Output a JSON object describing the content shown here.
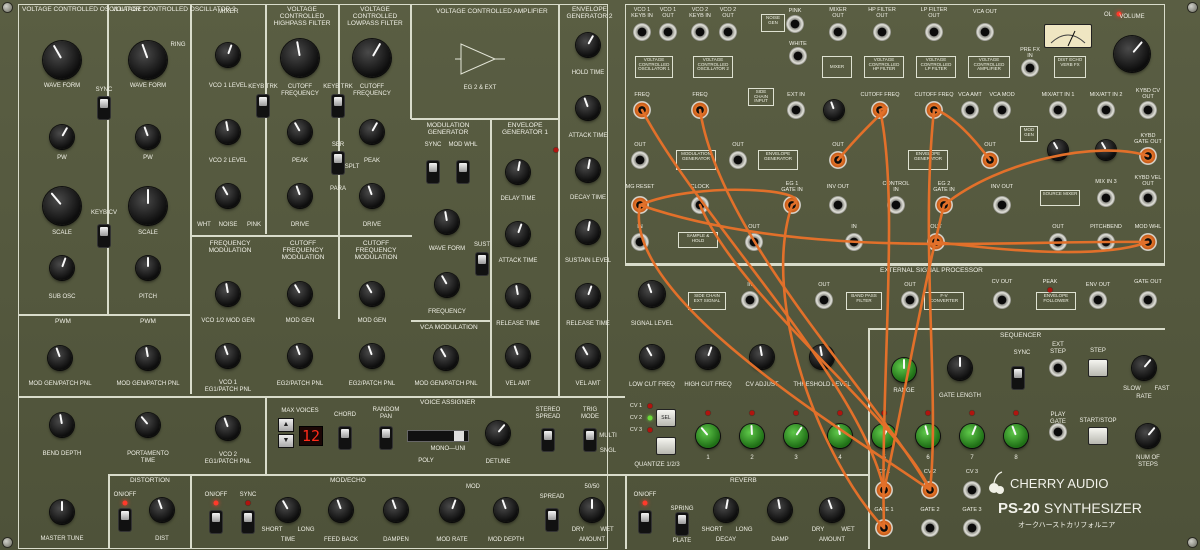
{
  "brand": {
    "company": "CHERRY AUDIO",
    "model_bold": "PS-20",
    "model_rest": "SYNTHESIZER",
    "japanese": "オークハーストカリフォルニア"
  },
  "sections": {
    "vco1": "VOLTAGE CONTROLLED OSCILLATOR  1",
    "vco2": "VOLTAGE CONTROLLED OSCILLATOR  2",
    "mixer": "MIXER",
    "hpf": "VOLTAGE CONTROLLED HIGHPASS FILTER",
    "lpf": "VOLTAGE CONTROLLED LOWPASS FILTER",
    "vca": "VOLTAGE CONTROLLED AMPLIFIER",
    "env2": "ENVELOPE GENERATOR 2",
    "modgen": "MODULATION GENERATOR",
    "env1": "ENVELOPE GENERATOR 1",
    "vcamod": "VCA MODULATION",
    "freqmod": "FREQUENCY MODULATION",
    "cutmod1": "CUTOFF FREQUENCY MODULATION",
    "cutmod2": "CUTOFF FREQUENCY MODULATION",
    "pwm1": "PWM",
    "pwm2": "PWM",
    "voice": "VOICE ASSIGNER",
    "distortion": "DISTORTION",
    "modecho": "MOD/ECHO",
    "reverb": "REVERB",
    "esp": "EXTERNAL SIGNAL PROCESSOR",
    "seq": "SEQUENCER"
  },
  "labels": {
    "wave_form": "WAVE FORM",
    "sync": "SYNC",
    "pw": "PW",
    "scale": "SCALE",
    "keyb_cv": "KEYB CV",
    "sub_osc": "SUB OSC",
    "pitch": "PITCH",
    "ring": "RING",
    "vco1_level": "VCO 1 LEVEL",
    "vco2_level": "VCO 2 LEVEL",
    "noise": "NOISE",
    "wht": "WHT",
    "pink": "PINK",
    "keyb_trk": "KEYB TRK",
    "cutoff_freq": "CUTOFF FREQUENCY",
    "peak": "PEAK",
    "drive": "DRIVE",
    "ser": "SER",
    "para": "PARA",
    "splt": "SPLT",
    "eg_ext": "EG 2 & EXT",
    "hold_time": "HOLD TIME",
    "attack_time": "ATTACK TIME",
    "decay_time": "DECAY TIME",
    "sustain_level": "SUSTAIN LEVEL",
    "release_time": "RELEASE TIME",
    "vel_amt": "VEL AMT",
    "delay_time": "DELAY TIME",
    "mod_whl": "MOD WHL",
    "sust": "SUST",
    "frequency": "FREQUENCY",
    "mod_gen_patch": "MOD GEN/PATCH PNL",
    "vco12_mod_gen": "VCO 1/2 MOD GEN",
    "mod_gen": "MOD GEN",
    "vco1_eg1": "VCO 1 EG1/PATCH PNL",
    "eg2_patch": "EG2/PATCH PNL",
    "vco2_eg1": "VCO 2 EG1/PATCH PNL",
    "bend_depth": "BEND DEPTH",
    "portamento": "PORTAMENTO TIME",
    "master_tune": "MASTER TUNE",
    "max_voices": "MAX VOICES",
    "chord": "CHORD",
    "random_pan": "RANDOM PAN",
    "poly": "POLY",
    "mono_uni": "MONO—UNI",
    "detune": "DETUNE",
    "stereo_spread": "STEREO SPREAD",
    "trig_mode": "TRIG MODE",
    "multi": "MULTI",
    "sngl": "SNGL",
    "on_off": "ON/OFF",
    "dist": "DIST",
    "time": "TIME",
    "short": "SHORT",
    "long": "LONG",
    "feed_back": "FEED BACK",
    "dampen": "DAMPEN",
    "mod_rate": "MOD RATE",
    "mod_depth": "MOD DEPTH",
    "mod": "MOD",
    "spread": "SPREAD",
    "amount": "AMOUNT",
    "dry": "DRY",
    "wet": "WET",
    "fifty": "50/50",
    "spring": "SPRING",
    "plate": "PLATE",
    "decay": "DECAY",
    "damp": "DAMP",
    "signal_level": "SIGNAL LEVEL",
    "low_cut": "LOW CUT FREQ",
    "high_cut": "HIGH CUT FREQ",
    "cv_adjust": "CV ADJUST",
    "threshold": "THRESHOLD LEVEL",
    "range": "RANGE",
    "gate_length": "GATE LENGTH",
    "ext_step": "EXT STEP",
    "step": "STEP",
    "rate": "RATE",
    "slow": "SLOW",
    "fast": "FAST",
    "play_gate": "PLAY GATE",
    "start_stop": "START/STOP",
    "num_steps": "NUM OF STEPS",
    "quantize": "QUANTIZE 1/2/3",
    "sel": "SEL",
    "volume": "VOLUME",
    "ol": "OL"
  },
  "patch_jacks": {
    "row1": [
      "VCO 1 KEYB IN",
      "VCO 1 OUT",
      "VCO 2 KEYB IN",
      "VCO 2 OUT",
      "PINK",
      "WHITE",
      "MIXER OUT",
      "HP FILTER OUT",
      "LP FILTER OUT",
      "VCA OUT",
      "PRE FX IN"
    ],
    "row2": [
      "FREQ",
      "FREQ",
      "EXT IN",
      "CUTOFF FREQ",
      "CUTOFF FREQ",
      "VCA AMT",
      "VCA MOD",
      "MIX/ATT IN 1",
      "MIX/ATT IN 2",
      "KYBD CV OUT"
    ],
    "row3": [
      "OUT",
      "OUT",
      "OUT",
      "OUT",
      "KYBD GATE OUT"
    ],
    "row4": [
      "MG RESET",
      "CLOCK",
      "EG 1 GATE IN",
      "INV OUT",
      "CONTROL IN",
      "EG 2 GATE IN",
      "INV OUT",
      "MIX IN 3",
      "KYBD VEL OUT"
    ],
    "row5": [
      "IN",
      "OUT",
      "IN",
      "OUT",
      "OUT",
      "PITCHBEND",
      "MOD WHL"
    ],
    "esp_row": [
      "IN",
      "OUT",
      "OUT",
      "CV OUT",
      "PEAK",
      "ENV OUT",
      "GATE OUT"
    ],
    "seq_out": [
      "CV 1",
      "CV 2",
      "CV 3",
      "GATE 1",
      "GATE 2",
      "GATE 3"
    ]
  },
  "patch_boxes": [
    "VOLTAGE CONTROLLED OSCILLATOR 1",
    "VOLTAGE CONTROLLED OSCILLATOR 2",
    "NOISE GEN",
    "MIXER",
    "VOLTAGE CONTROLLED HP FILTER",
    "VOLTAGE CONTROLLED LP FILTER",
    "VOLTAGE CONTROLLED AMPLIFIER",
    "DIST ECHO VERB FX",
    "SIDE CHAIN INPUT",
    "MODULATION GENERATOR",
    "ENVELOPE GENERATOR",
    "ENVELOPE GENERATOR",
    "SOURCE MIXER",
    "SAMPLE & HOLD",
    "SIDE CHAIN EXT SIGNAL",
    "BAND PASS FILTER",
    "F-V CONVERTER",
    "ENVELOPE FOLLOWER",
    "MOD GEN"
  ],
  "voice_display": "12",
  "sequencer_steps": [
    "1",
    "2",
    "3",
    "4",
    "5",
    "6",
    "7",
    "8"
  ],
  "cv_select": [
    "CV 1",
    "CV 2",
    "CV 3"
  ],
  "colors": {
    "panel": "#545840",
    "cable": "#e2702a",
    "led": "#e8261b",
    "knob": "#111111",
    "seq_knob": "#3fa82e"
  }
}
